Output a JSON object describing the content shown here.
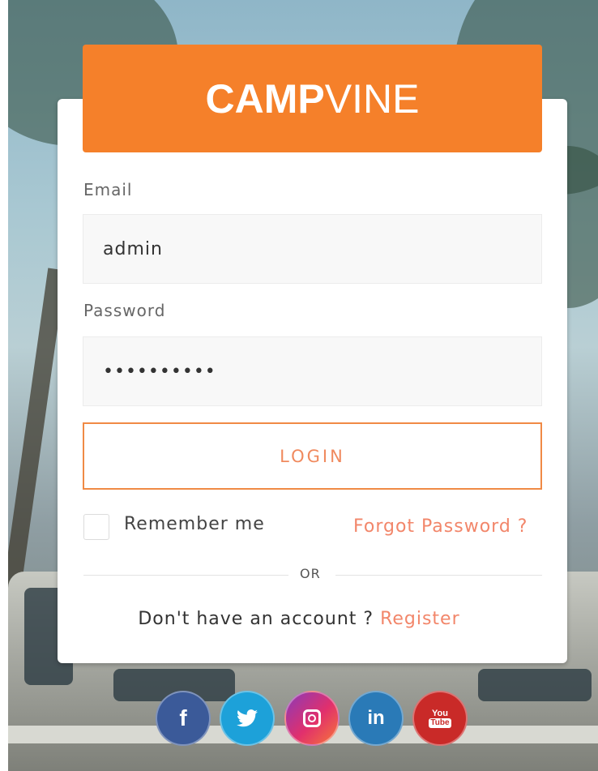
{
  "brand": {
    "name_bold": "CAMP",
    "name_thin": "VINE",
    "color": "#f5802a"
  },
  "form": {
    "email_label": "Email",
    "email_value": "admin",
    "password_label": "Password",
    "password_value": "••••••••••",
    "login_label": "LOGIN",
    "remember_label": "Remember me",
    "remember_checked": false,
    "forgot_label": "Forgot Password ?",
    "or_label": "OR",
    "no_account_text": "Don't have an account ?",
    "register_label": "Register"
  },
  "colors": {
    "accent": "#f5802a",
    "link": "#f2866a"
  },
  "social": [
    {
      "name": "facebook",
      "glyph": "f",
      "color": "#3b5a99"
    },
    {
      "name": "twitter",
      "glyph": "🐦",
      "color": "#1da1d9"
    },
    {
      "name": "instagram",
      "glyph": "instagram-icon",
      "color": "#e1306c"
    },
    {
      "name": "linkedin",
      "glyph": "in",
      "color": "#2a7ab7"
    },
    {
      "name": "youtube",
      "glyph_top": "You",
      "glyph_bottom": "Tube",
      "color": "#c92a28"
    }
  ]
}
